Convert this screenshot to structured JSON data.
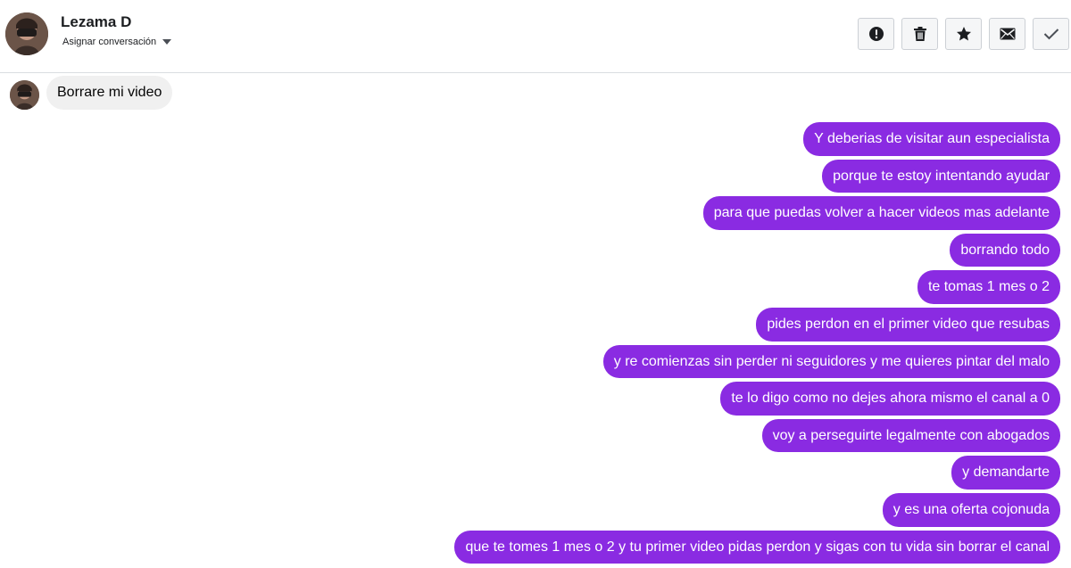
{
  "header": {
    "contact_name": "Lezama D",
    "assign_label": "Asignar conversación",
    "actions": [
      {
        "icon": "alert-icon",
        "label": "spam"
      },
      {
        "icon": "trash-icon",
        "label": "delete"
      },
      {
        "icon": "star-icon",
        "label": "star"
      },
      {
        "icon": "mail-icon",
        "label": "unread"
      },
      {
        "icon": "check-icon",
        "label": "done"
      }
    ]
  },
  "incoming_messages": [
    "Borrare mi video"
  ],
  "outgoing_messages": [
    "Y deberias de visitar aun especialista",
    "porque te estoy intentando ayudar",
    "para que puedas volver a hacer videos mas adelante",
    "borrando todo",
    "te tomas 1 mes o 2",
    "pides perdon en el primer video que resubas",
    "y re comienzas sin perder ni seguidores y me quieres pintar del malo",
    "te lo digo como no dejes ahora mismo el canal a 0",
    "voy a perseguirte legalmente con abogados",
    "y demandarte",
    "y es una oferta cojonuda",
    "que te tomes 1 mes o 2 y tu primer video pidas perdon y sigas con tu vida sin borrar el canal"
  ],
  "colors": {
    "outgoing_bubble": "#8a2be2",
    "incoming_bubble": "#f0f0f0",
    "icon": "#1c1e21"
  }
}
